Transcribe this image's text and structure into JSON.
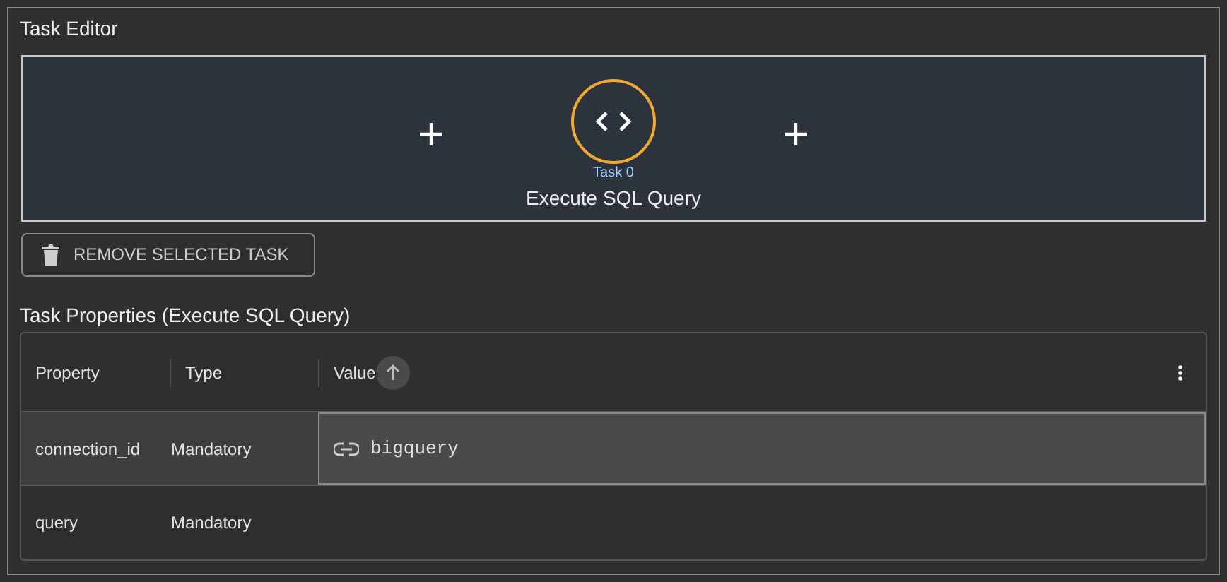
{
  "panel": {
    "title": "Task Editor"
  },
  "canvas": {
    "tasks": [
      {
        "label": "Task 0",
        "name": "Execute SQL Query",
        "selected": true
      }
    ]
  },
  "remove_button": {
    "label": "REMOVE SELECTED TASK"
  },
  "properties": {
    "title": "Task Properties (Execute SQL Query)",
    "columns": [
      {
        "label": "Property",
        "sorted": false
      },
      {
        "label": "Type",
        "sorted": false
      },
      {
        "label": "Value",
        "sorted": true
      }
    ],
    "rows": [
      {
        "property": "connection_id",
        "type": "Mandatory",
        "value": "bigquery",
        "selected": true
      },
      {
        "property": "query",
        "type": "Mandatory",
        "selected": false
      }
    ]
  }
}
